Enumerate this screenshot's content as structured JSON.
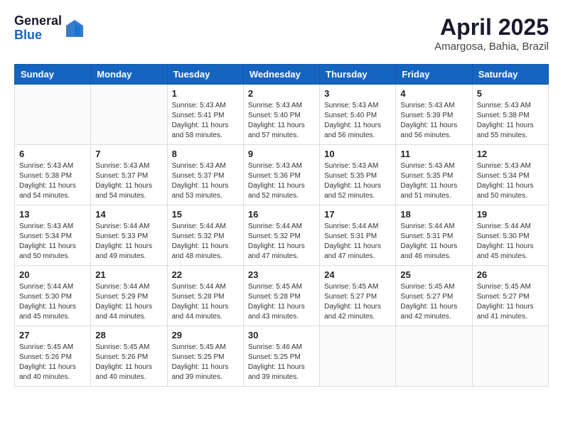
{
  "header": {
    "logo_general": "General",
    "logo_blue": "Blue",
    "month_year": "April 2025",
    "location": "Amargosa, Bahia, Brazil"
  },
  "calendar": {
    "days_of_week": [
      "Sunday",
      "Monday",
      "Tuesday",
      "Wednesday",
      "Thursday",
      "Friday",
      "Saturday"
    ],
    "weeks": [
      [
        {
          "day": "",
          "info": ""
        },
        {
          "day": "",
          "info": ""
        },
        {
          "day": "1",
          "info": "Sunrise: 5:43 AM\nSunset: 5:41 PM\nDaylight: 11 hours and 58 minutes."
        },
        {
          "day": "2",
          "info": "Sunrise: 5:43 AM\nSunset: 5:40 PM\nDaylight: 11 hours and 57 minutes."
        },
        {
          "day": "3",
          "info": "Sunrise: 5:43 AM\nSunset: 5:40 PM\nDaylight: 11 hours and 56 minutes."
        },
        {
          "day": "4",
          "info": "Sunrise: 5:43 AM\nSunset: 5:39 PM\nDaylight: 11 hours and 56 minutes."
        },
        {
          "day": "5",
          "info": "Sunrise: 5:43 AM\nSunset: 5:38 PM\nDaylight: 11 hours and 55 minutes."
        }
      ],
      [
        {
          "day": "6",
          "info": "Sunrise: 5:43 AM\nSunset: 5:38 PM\nDaylight: 11 hours and 54 minutes."
        },
        {
          "day": "7",
          "info": "Sunrise: 5:43 AM\nSunset: 5:37 PM\nDaylight: 11 hours and 54 minutes."
        },
        {
          "day": "8",
          "info": "Sunrise: 5:43 AM\nSunset: 5:37 PM\nDaylight: 11 hours and 53 minutes."
        },
        {
          "day": "9",
          "info": "Sunrise: 5:43 AM\nSunset: 5:36 PM\nDaylight: 11 hours and 52 minutes."
        },
        {
          "day": "10",
          "info": "Sunrise: 5:43 AM\nSunset: 5:35 PM\nDaylight: 11 hours and 52 minutes."
        },
        {
          "day": "11",
          "info": "Sunrise: 5:43 AM\nSunset: 5:35 PM\nDaylight: 11 hours and 51 minutes."
        },
        {
          "day": "12",
          "info": "Sunrise: 5:43 AM\nSunset: 5:34 PM\nDaylight: 11 hours and 50 minutes."
        }
      ],
      [
        {
          "day": "13",
          "info": "Sunrise: 5:43 AM\nSunset: 5:34 PM\nDaylight: 11 hours and 50 minutes."
        },
        {
          "day": "14",
          "info": "Sunrise: 5:44 AM\nSunset: 5:33 PM\nDaylight: 11 hours and 49 minutes."
        },
        {
          "day": "15",
          "info": "Sunrise: 5:44 AM\nSunset: 5:32 PM\nDaylight: 11 hours and 48 minutes."
        },
        {
          "day": "16",
          "info": "Sunrise: 5:44 AM\nSunset: 5:32 PM\nDaylight: 11 hours and 47 minutes."
        },
        {
          "day": "17",
          "info": "Sunrise: 5:44 AM\nSunset: 5:31 PM\nDaylight: 11 hours and 47 minutes."
        },
        {
          "day": "18",
          "info": "Sunrise: 5:44 AM\nSunset: 5:31 PM\nDaylight: 11 hours and 46 minutes."
        },
        {
          "day": "19",
          "info": "Sunrise: 5:44 AM\nSunset: 5:30 PM\nDaylight: 11 hours and 45 minutes."
        }
      ],
      [
        {
          "day": "20",
          "info": "Sunrise: 5:44 AM\nSunset: 5:30 PM\nDaylight: 11 hours and 45 minutes."
        },
        {
          "day": "21",
          "info": "Sunrise: 5:44 AM\nSunset: 5:29 PM\nDaylight: 11 hours and 44 minutes."
        },
        {
          "day": "22",
          "info": "Sunrise: 5:44 AM\nSunset: 5:28 PM\nDaylight: 11 hours and 44 minutes."
        },
        {
          "day": "23",
          "info": "Sunrise: 5:45 AM\nSunset: 5:28 PM\nDaylight: 11 hours and 43 minutes."
        },
        {
          "day": "24",
          "info": "Sunrise: 5:45 AM\nSunset: 5:27 PM\nDaylight: 11 hours and 42 minutes."
        },
        {
          "day": "25",
          "info": "Sunrise: 5:45 AM\nSunset: 5:27 PM\nDaylight: 11 hours and 42 minutes."
        },
        {
          "day": "26",
          "info": "Sunrise: 5:45 AM\nSunset: 5:27 PM\nDaylight: 11 hours and 41 minutes."
        }
      ],
      [
        {
          "day": "27",
          "info": "Sunrise: 5:45 AM\nSunset: 5:26 PM\nDaylight: 11 hours and 40 minutes."
        },
        {
          "day": "28",
          "info": "Sunrise: 5:45 AM\nSunset: 5:26 PM\nDaylight: 11 hours and 40 minutes."
        },
        {
          "day": "29",
          "info": "Sunrise: 5:45 AM\nSunset: 5:25 PM\nDaylight: 11 hours and 39 minutes."
        },
        {
          "day": "30",
          "info": "Sunrise: 5:46 AM\nSunset: 5:25 PM\nDaylight: 11 hours and 39 minutes."
        },
        {
          "day": "",
          "info": ""
        },
        {
          "day": "",
          "info": ""
        },
        {
          "day": "",
          "info": ""
        }
      ]
    ]
  }
}
